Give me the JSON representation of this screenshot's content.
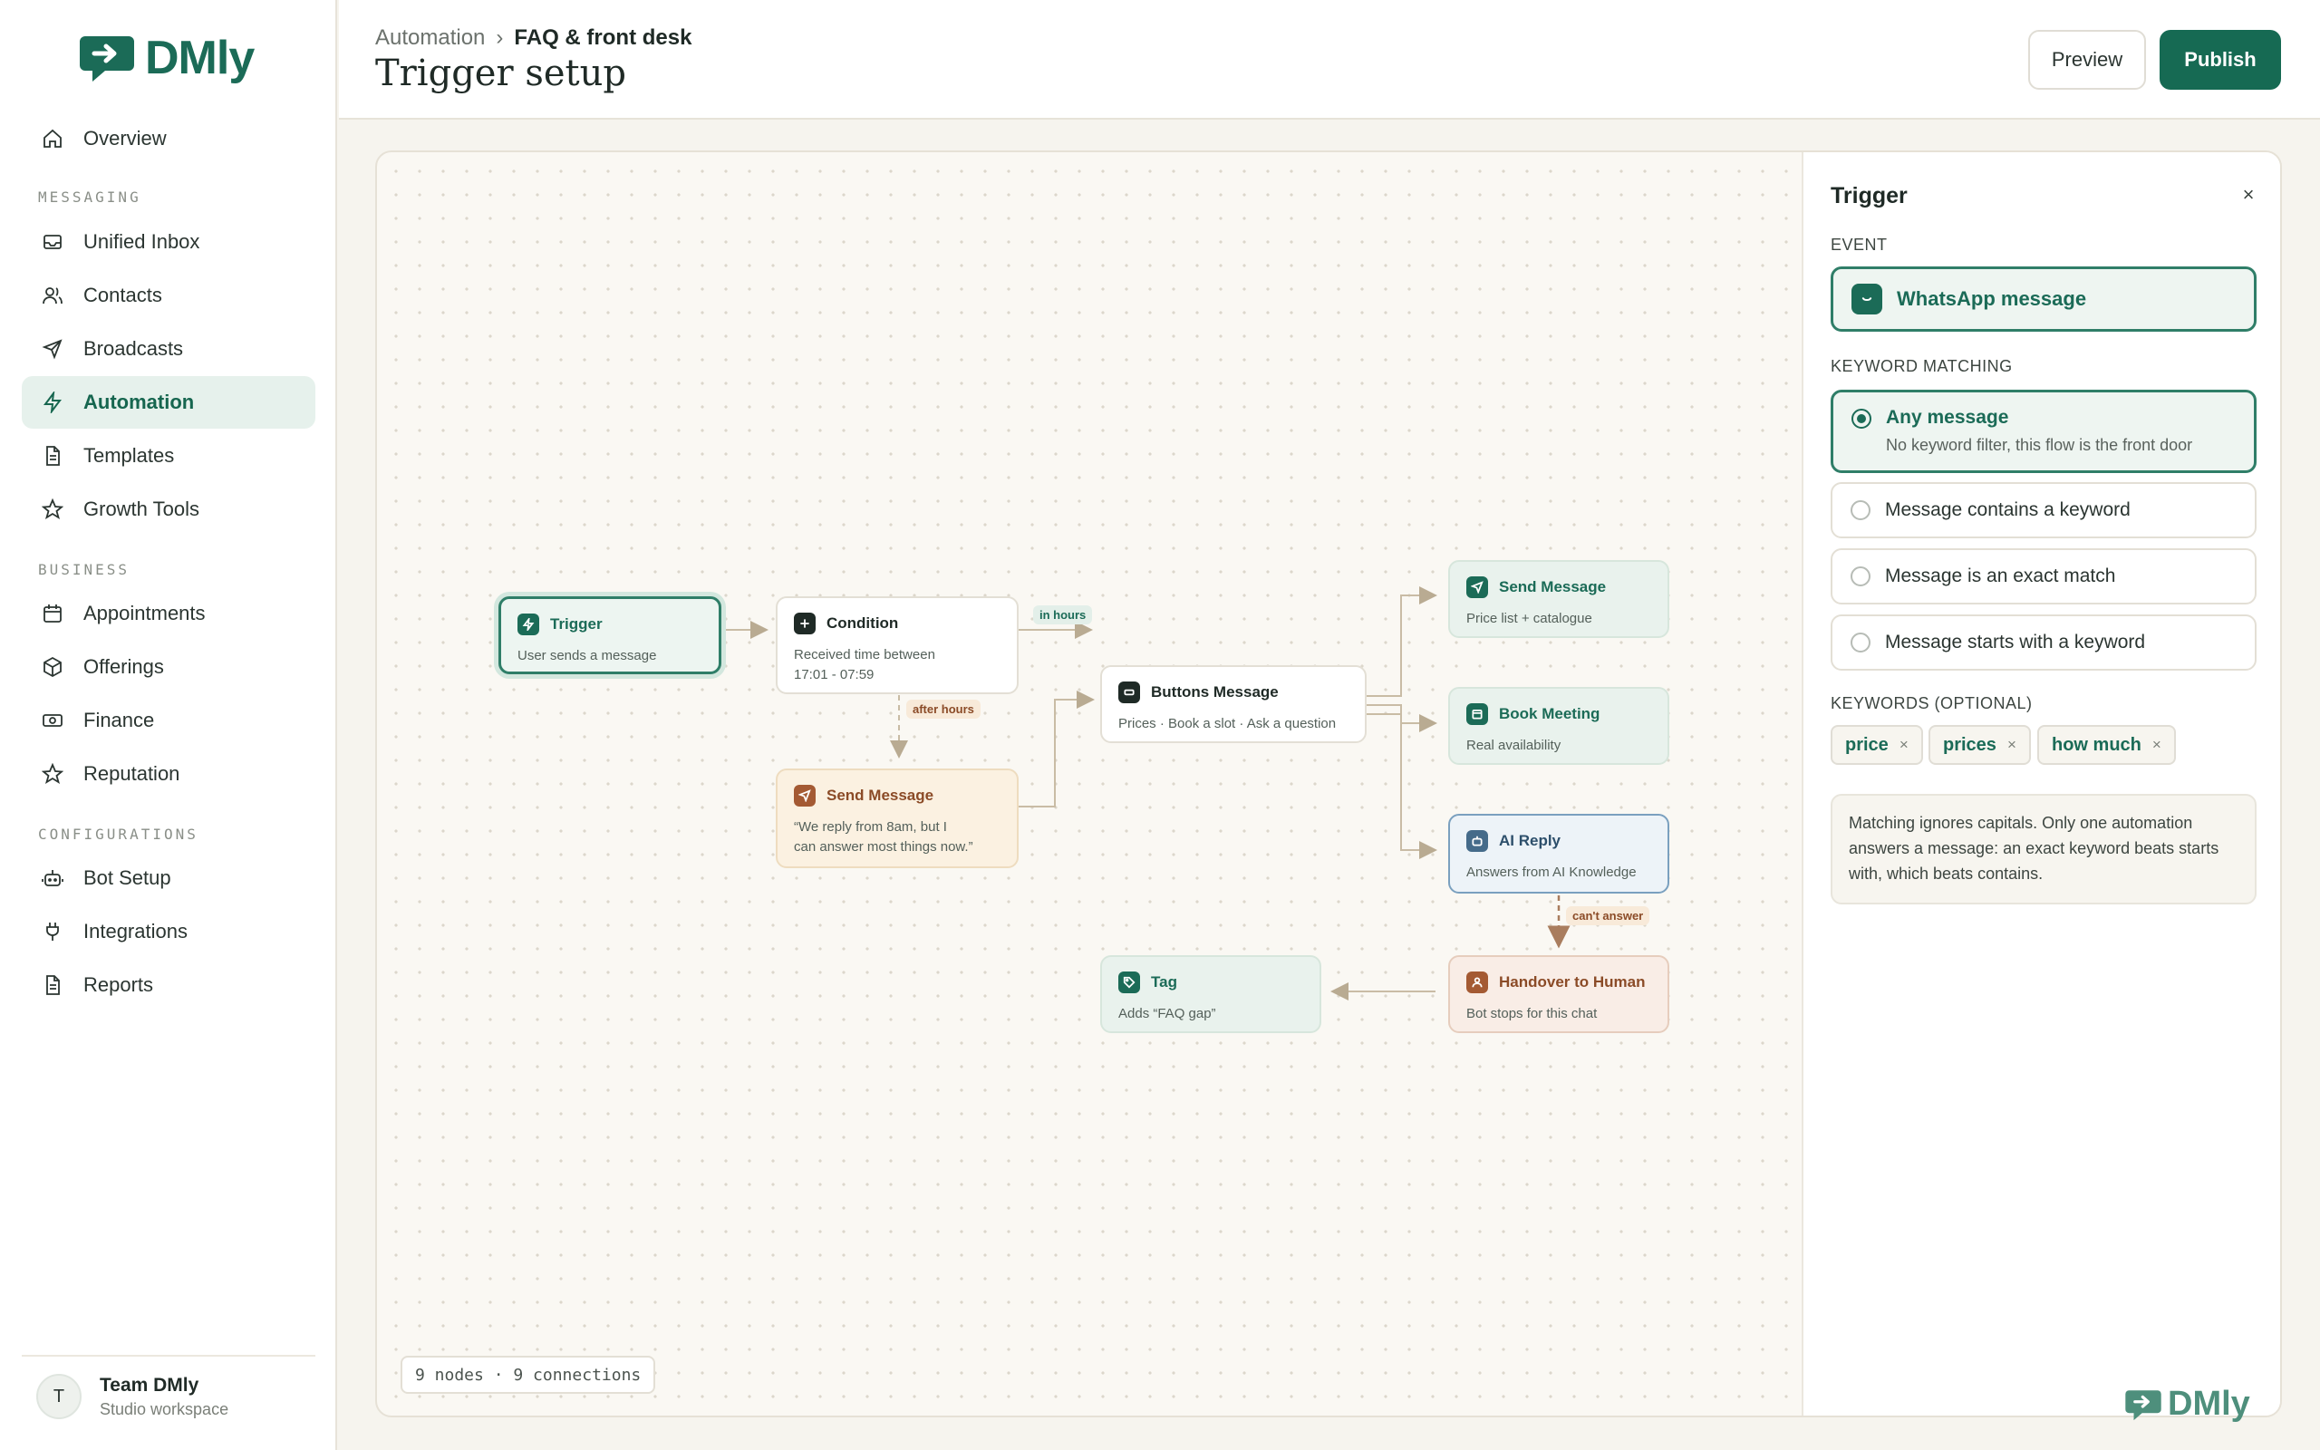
{
  "brand": {
    "name": "DMly"
  },
  "sidebar": {
    "overview": "Overview",
    "sections": {
      "messaging": "MESSAGING",
      "business": "BUSINESS",
      "configurations": "CONFIGURATIONS"
    },
    "items": {
      "unified_inbox": "Unified Inbox",
      "contacts": "Contacts",
      "broadcasts": "Broadcasts",
      "automation": "Automation",
      "templates": "Templates",
      "growth_tools": "Growth Tools",
      "appointments": "Appointments",
      "offerings": "Offerings",
      "finance": "Finance",
      "reputation": "Reputation",
      "bot_setup": "Bot Setup",
      "integrations": "Integrations",
      "reports": "Reports"
    },
    "team": {
      "initial": "T",
      "name": "Team DMly",
      "subtitle": "Studio workspace"
    }
  },
  "header": {
    "breadcrumb_root": "Automation",
    "breadcrumb_sep": "›",
    "breadcrumb_current": "FAQ & front desk",
    "title": "Trigger setup",
    "preview_label": "Preview",
    "publish_label": "Publish"
  },
  "flow": {
    "nodes": {
      "trigger": {
        "title": "Trigger",
        "sub": "User sends a message"
      },
      "condition": {
        "title": "Condition",
        "sub1": "Received time between",
        "sub2": "17:01 - 07:59"
      },
      "send_after_hours": {
        "title": "Send Message",
        "sub1": "“We reply from 8am, but I",
        "sub2": "can answer most things now.”"
      },
      "buttons": {
        "title": "Buttons Message",
        "sub": "Prices · Book a slot · Ask a question"
      },
      "send_price": {
        "title": "Send Message",
        "sub": "Price list + catalogue"
      },
      "book_meeting": {
        "title": "Book Meeting",
        "sub": "Real availability"
      },
      "ai_reply": {
        "title": "AI Reply",
        "sub": "Answers from AI Knowledge"
      },
      "handover": {
        "title": "Handover to Human",
        "sub": "Bot stops for this chat"
      },
      "tag": {
        "title": "Tag",
        "sub": "Adds “FAQ gap”"
      }
    },
    "labels": {
      "in_hours": "in hours",
      "after_hours": "after hours",
      "cant_answer": "can't answer"
    },
    "footer": "9 nodes · 9 connections"
  },
  "panel": {
    "title": "Trigger",
    "close": "×",
    "event_label": "EVENT",
    "event_value": "WhatsApp message",
    "keyword_label": "KEYWORD MATCHING",
    "options": {
      "any": {
        "title": "Any message",
        "desc": "No keyword filter, this flow is the front door"
      },
      "contains": {
        "title": "Message contains a keyword"
      },
      "exact": {
        "title": "Message is an exact match"
      },
      "starts": {
        "title": "Message starts with a keyword"
      }
    },
    "keywords_label": "KEYWORDS (OPTIONAL)",
    "keywords": [
      "price",
      "prices",
      "how much"
    ],
    "chip_remove": "×",
    "info": "Matching ignores capitals. Only one automation answers a message: an exact keyword beats starts with, which beats contains."
  },
  "colors": {
    "brand": "#1b6b57",
    "accent_orange": "#a45a33",
    "accent_blue": "#456b8a"
  }
}
